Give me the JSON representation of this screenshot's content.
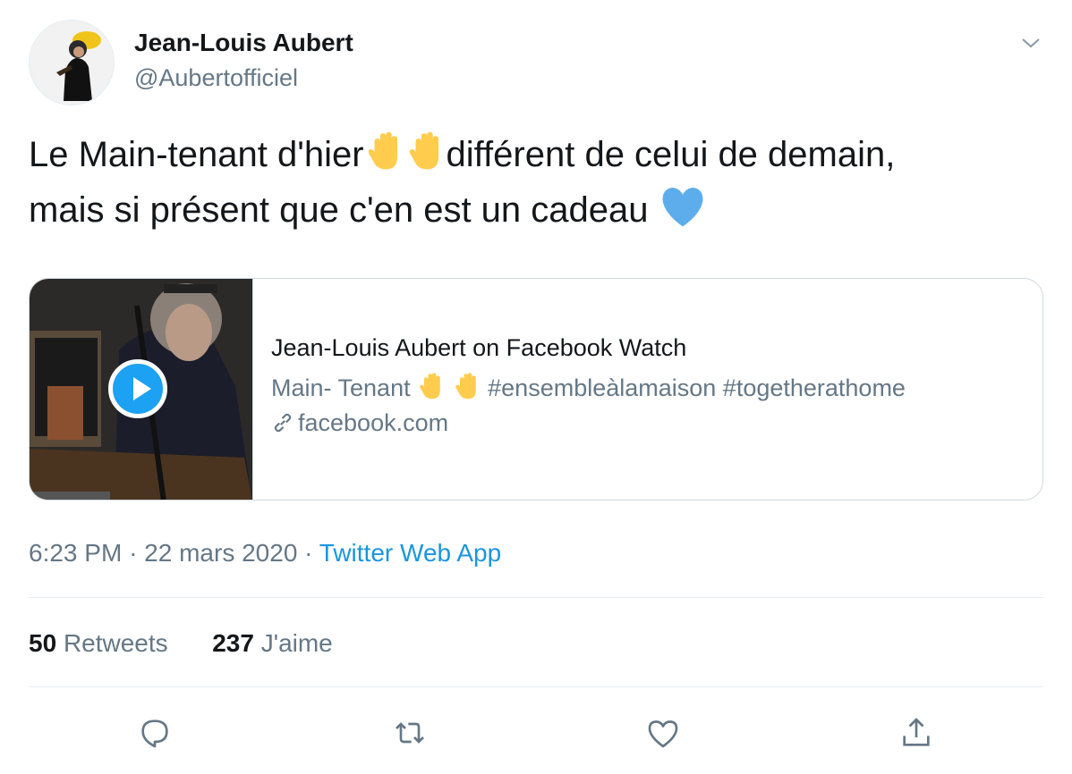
{
  "author": {
    "name": "Jean-Louis Aubert",
    "handle": "@Aubertofficiel"
  },
  "tweet": {
    "line1a": "Le Main-tenant d'hier",
    "line1b": "différent de celui de demain,",
    "line2": "mais si présent que c'en est un cadeau",
    "emojis": [
      "raised-hand-emoji",
      "raised-hand-emoji",
      "blue-heart-emoji"
    ]
  },
  "card": {
    "title": "Jean-Louis Aubert on Facebook Watch",
    "desc_prefix": "Main- Tenant",
    "desc_tags": "#ensembleàlamaison #togetherathome",
    "domain": "facebook.com"
  },
  "meta": {
    "time": "6:23 PM",
    "sep": "·",
    "date": "22 mars 2020",
    "app": "Twitter Web App"
  },
  "stats": {
    "retweets_count": "50",
    "retweets_label": "Retweets",
    "likes_count": "237",
    "likes_label": "J'aime"
  },
  "actions": [
    "reply-icon",
    "retweet-icon",
    "like-icon",
    "share-icon"
  ],
  "colors": {
    "accent": "#1da1f2",
    "link": "#1b95e0",
    "muted": "#657786",
    "text": "#14171a",
    "border": "#e6ecf0"
  }
}
